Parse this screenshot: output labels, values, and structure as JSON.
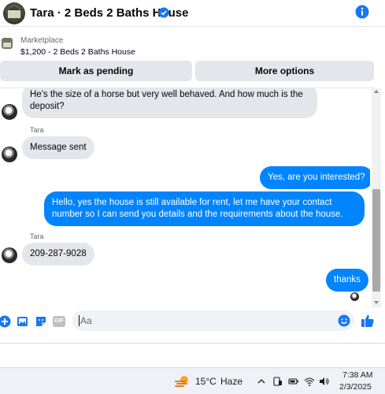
{
  "header": {
    "title": "Tara · 2 Beds 2 Baths House"
  },
  "marketplace": {
    "label": "Marketplace",
    "listing": "$1,200 - 2 Beds 2 Baths House"
  },
  "actions": {
    "mark_pending": "Mark as pending",
    "more_options": "More options"
  },
  "messages": [
    {
      "from": "them",
      "text": "He's the size of a horse but very well behaved. And how much is the deposit?"
    },
    {
      "from": "them",
      "sender": "Tara",
      "text": "Message sent"
    },
    {
      "from": "me",
      "text": "Yes, are you interested?"
    },
    {
      "from": "me",
      "text": "Hello, yes the house is still available for rent, let me have your contact number so I can send you details and the requirements about the house."
    },
    {
      "from": "them",
      "sender": "Tara",
      "text": "209-287-9028"
    },
    {
      "from": "me",
      "text": "thanks"
    }
  ],
  "composer": {
    "placeholder": "Aa",
    "gif_label": "GIF"
  },
  "taskbar": {
    "temperature": "15°C",
    "condition": "Haze",
    "time": "7:38 AM",
    "date": "2/3/2025"
  },
  "colors": {
    "accent": "#0084ff",
    "incoming_bubble": "#e4e6eb",
    "icon_blue": "#1877f2"
  },
  "icons": [
    "verified-icon",
    "info-icon",
    "add-icon",
    "image-icon",
    "sticker-icon",
    "gif-icon",
    "emoji-icon",
    "like-icon",
    "weather-icon",
    "chevron-up-icon",
    "phone-link-icon",
    "battery-icon",
    "wifi-icon",
    "volume-icon"
  ]
}
